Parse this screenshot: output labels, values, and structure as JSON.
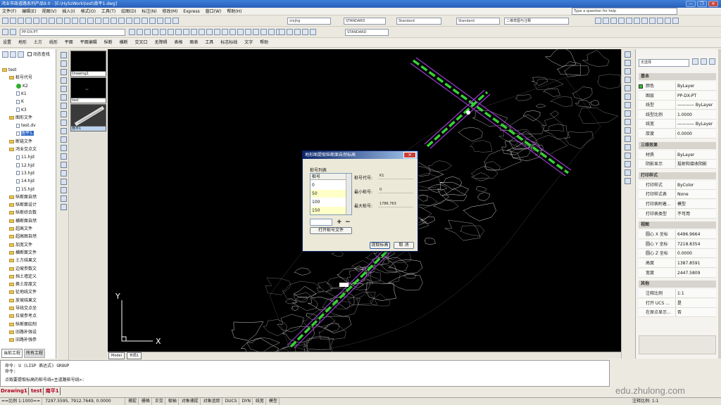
{
  "window": {
    "title": "鸿业市政道路系列产品9.0 - [E:\\HySzWork\\test\\南平1.dwg]",
    "controls": [
      "—",
      "❐",
      "✕"
    ]
  },
  "menu": [
    "文件(F)",
    "编辑(E)",
    "视图(V)",
    "插入(I)",
    "格式(O)",
    "工具(T)",
    "绘图(D)",
    "标注(N)",
    "修改(M)",
    "Express",
    "窗口(W)",
    "帮助(H)"
  ],
  "help_search_placeholder": "Type a question for help",
  "toolbar": {
    "text_style": "zrxjhg",
    "text_style_std": "STANDARD",
    "dim_style": "Standard",
    "table_style": "Standard",
    "workspace": "二维草图与注释",
    "layer": "PP-DX-PT",
    "std2": "STANDARD"
  },
  "cad_menu": [
    "设置",
    "地形",
    "土方",
    "线形",
    "平面",
    "平面编辑",
    "纵断",
    "横断",
    "交叉口",
    "无障碍",
    "表格",
    "图表",
    "工具",
    "标志标线",
    "文字",
    "帮助"
  ],
  "left_panel": {
    "header_button": "动态查找",
    "tree": [
      {
        "label": "test",
        "level": 0,
        "kind": "folder"
      },
      {
        "label": "桩号代号",
        "level": 1,
        "kind": "folder"
      },
      {
        "label": "K2",
        "level": 2,
        "kind": "item-check"
      },
      {
        "label": "K1",
        "level": 2,
        "kind": "item"
      },
      {
        "label": "K",
        "level": 2,
        "kind": "item"
      },
      {
        "label": "K3",
        "level": 2,
        "kind": "item"
      },
      {
        "label": "图形文件",
        "level": 1,
        "kind": "folder"
      },
      {
        "label": "test.dv",
        "level": 2,
        "kind": "file"
      },
      {
        "label": "南平1.",
        "level": 2,
        "kind": "file-selected"
      },
      {
        "label": "断链文件",
        "level": 1,
        "kind": "folder"
      },
      {
        "label": "鸿业交点文",
        "level": 1,
        "kind": "folder"
      },
      {
        "label": "11.hjd",
        "level": 2,
        "kind": "file"
      },
      {
        "label": "12.hjd",
        "level": 2,
        "kind": "file"
      },
      {
        "label": "13.hjd",
        "level": 2,
        "kind": "file"
      },
      {
        "label": "14.hjd",
        "level": 2,
        "kind": "file"
      },
      {
        "label": "15.hjd",
        "level": 2,
        "kind": "file"
      },
      {
        "label": "纵断面自然",
        "level": 1,
        "kind": "folder"
      },
      {
        "label": "纵断面设计",
        "level": 1,
        "kind": "folder"
      },
      {
        "label": "纵断综合数",
        "level": 1,
        "kind": "folder"
      },
      {
        "label": "横断面自然",
        "level": 1,
        "kind": "folder"
      },
      {
        "label": "超高文件",
        "level": 1,
        "kind": "folder"
      },
      {
        "label": "超高图自然",
        "level": 1,
        "kind": "folder"
      },
      {
        "label": "加宽文件",
        "level": 1,
        "kind": "folder"
      },
      {
        "label": "横断面文件",
        "level": 1,
        "kind": "folder"
      },
      {
        "label": "土方结果文",
        "level": 1,
        "kind": "folder"
      },
      {
        "label": "边坡参数文",
        "level": 1,
        "kind": "folder"
      },
      {
        "label": "挡土墙定义",
        "level": 1,
        "kind": "folder"
      },
      {
        "label": "换土厚度文",
        "level": 1,
        "kind": "folder"
      },
      {
        "label": "征地线文件",
        "level": 1,
        "kind": "folder"
      },
      {
        "label": "放坡结果文",
        "level": 1,
        "kind": "folder"
      },
      {
        "label": "导线交点坐",
        "level": 1,
        "kind": "folder"
      },
      {
        "label": "拉坡参考点",
        "level": 1,
        "kind": "folder"
      },
      {
        "label": "纵断面绘制",
        "level": 1,
        "kind": "folder"
      },
      {
        "label": "旧路补强设",
        "level": 1,
        "kind": "folder"
      },
      {
        "label": "旧路补强参",
        "level": 1,
        "kind": "folder"
      }
    ],
    "bottom_tabs": [
      "当前工程",
      "所有工程"
    ]
  },
  "thumbnails": [
    {
      "label": "Drawing1"
    },
    {
      "label": "test"
    },
    {
      "label": "南平1"
    }
  ],
  "canvas_tabs": [
    "Model",
    "布局1"
  ],
  "axis": {
    "x": "X",
    "y": "Y"
  },
  "dialog": {
    "title": "地形图提取纵断面自然标高",
    "close": "✕",
    "group_label": "桩号列表",
    "list_header": "桩号",
    "list_items": [
      "0",
      "50",
      "100",
      "150"
    ],
    "code_label": "桩号代号:",
    "code_value": "K1",
    "min_label": "最小桩号:",
    "min_value": "0",
    "max_label": "最大桩号:",
    "max_value": "1786.763",
    "plus": "+",
    "minus": "−",
    "open_btn": "打开桩号文件",
    "extract_btn": "提取标高",
    "cancel_btn": "取 消"
  },
  "properties": {
    "selection": "无选择",
    "sections": [
      {
        "title": "基本",
        "rows": [
          [
            "颜色",
            "ByLayer"
          ],
          [
            "图层",
            "PP-DX-PT"
          ],
          [
            "线型",
            "———— ByLayer"
          ],
          [
            "线型比例",
            "1.0000"
          ],
          [
            "线宽",
            "———— ByLayer"
          ],
          [
            "厚度",
            "0.0000"
          ]
        ]
      },
      {
        "title": "三维效果",
        "rows": [
          [
            "材质",
            "ByLayer"
          ],
          [
            "阴影显示",
            "投射和接收阴影"
          ]
        ]
      },
      {
        "title": "打印样式",
        "rows": [
          [
            "打印样式",
            "ByColor"
          ],
          [
            "打印样式表",
            "None"
          ],
          [
            "打印表附着...",
            "模型"
          ],
          [
            "打印表类型",
            "不可用"
          ]
        ]
      },
      {
        "title": "视图",
        "rows": [
          [
            "圆心 X 坐标",
            "6496.9664"
          ],
          [
            "圆心 Y 坐标",
            "7218.8354"
          ],
          [
            "圆心 Z 坐标",
            "0.0000"
          ],
          [
            "高度",
            "1387.8591"
          ],
          [
            "宽度",
            "2447.5809"
          ]
        ]
      },
      {
        "title": "其他",
        "rows": [
          [
            "注释比例",
            "1:1"
          ],
          [
            "打开 UCS ...",
            "是"
          ],
          [
            "在原点显示...",
            "否"
          ]
        ]
      }
    ]
  },
  "command": {
    "lines": [
      "命令:  U (LISP 表达式) GROUP",
      "命令:",
      "  点取要提取标高的桩号线<主道路桩号线>:"
    ]
  },
  "window_tabs": [
    "Drawing1",
    "test",
    "南平1"
  ],
  "status": {
    "scale": "==比例 1:1000==",
    "coords": "7297.5595, 7912.7649, 0.0000",
    "toggles": [
      "捕捉",
      "栅格",
      "正交",
      "极轴",
      "对象捕捉",
      "对象追踪",
      "DUCS",
      "DYN",
      "线宽",
      "模型"
    ],
    "annot_scale": "注释比例: 1:1"
  },
  "watermark": "edu.zhulong.com",
  "colors": {
    "road_green": "#35d435",
    "road_purple": "#9d3bd1",
    "contour": "#e6e6e6",
    "canvas": "#000000"
  }
}
